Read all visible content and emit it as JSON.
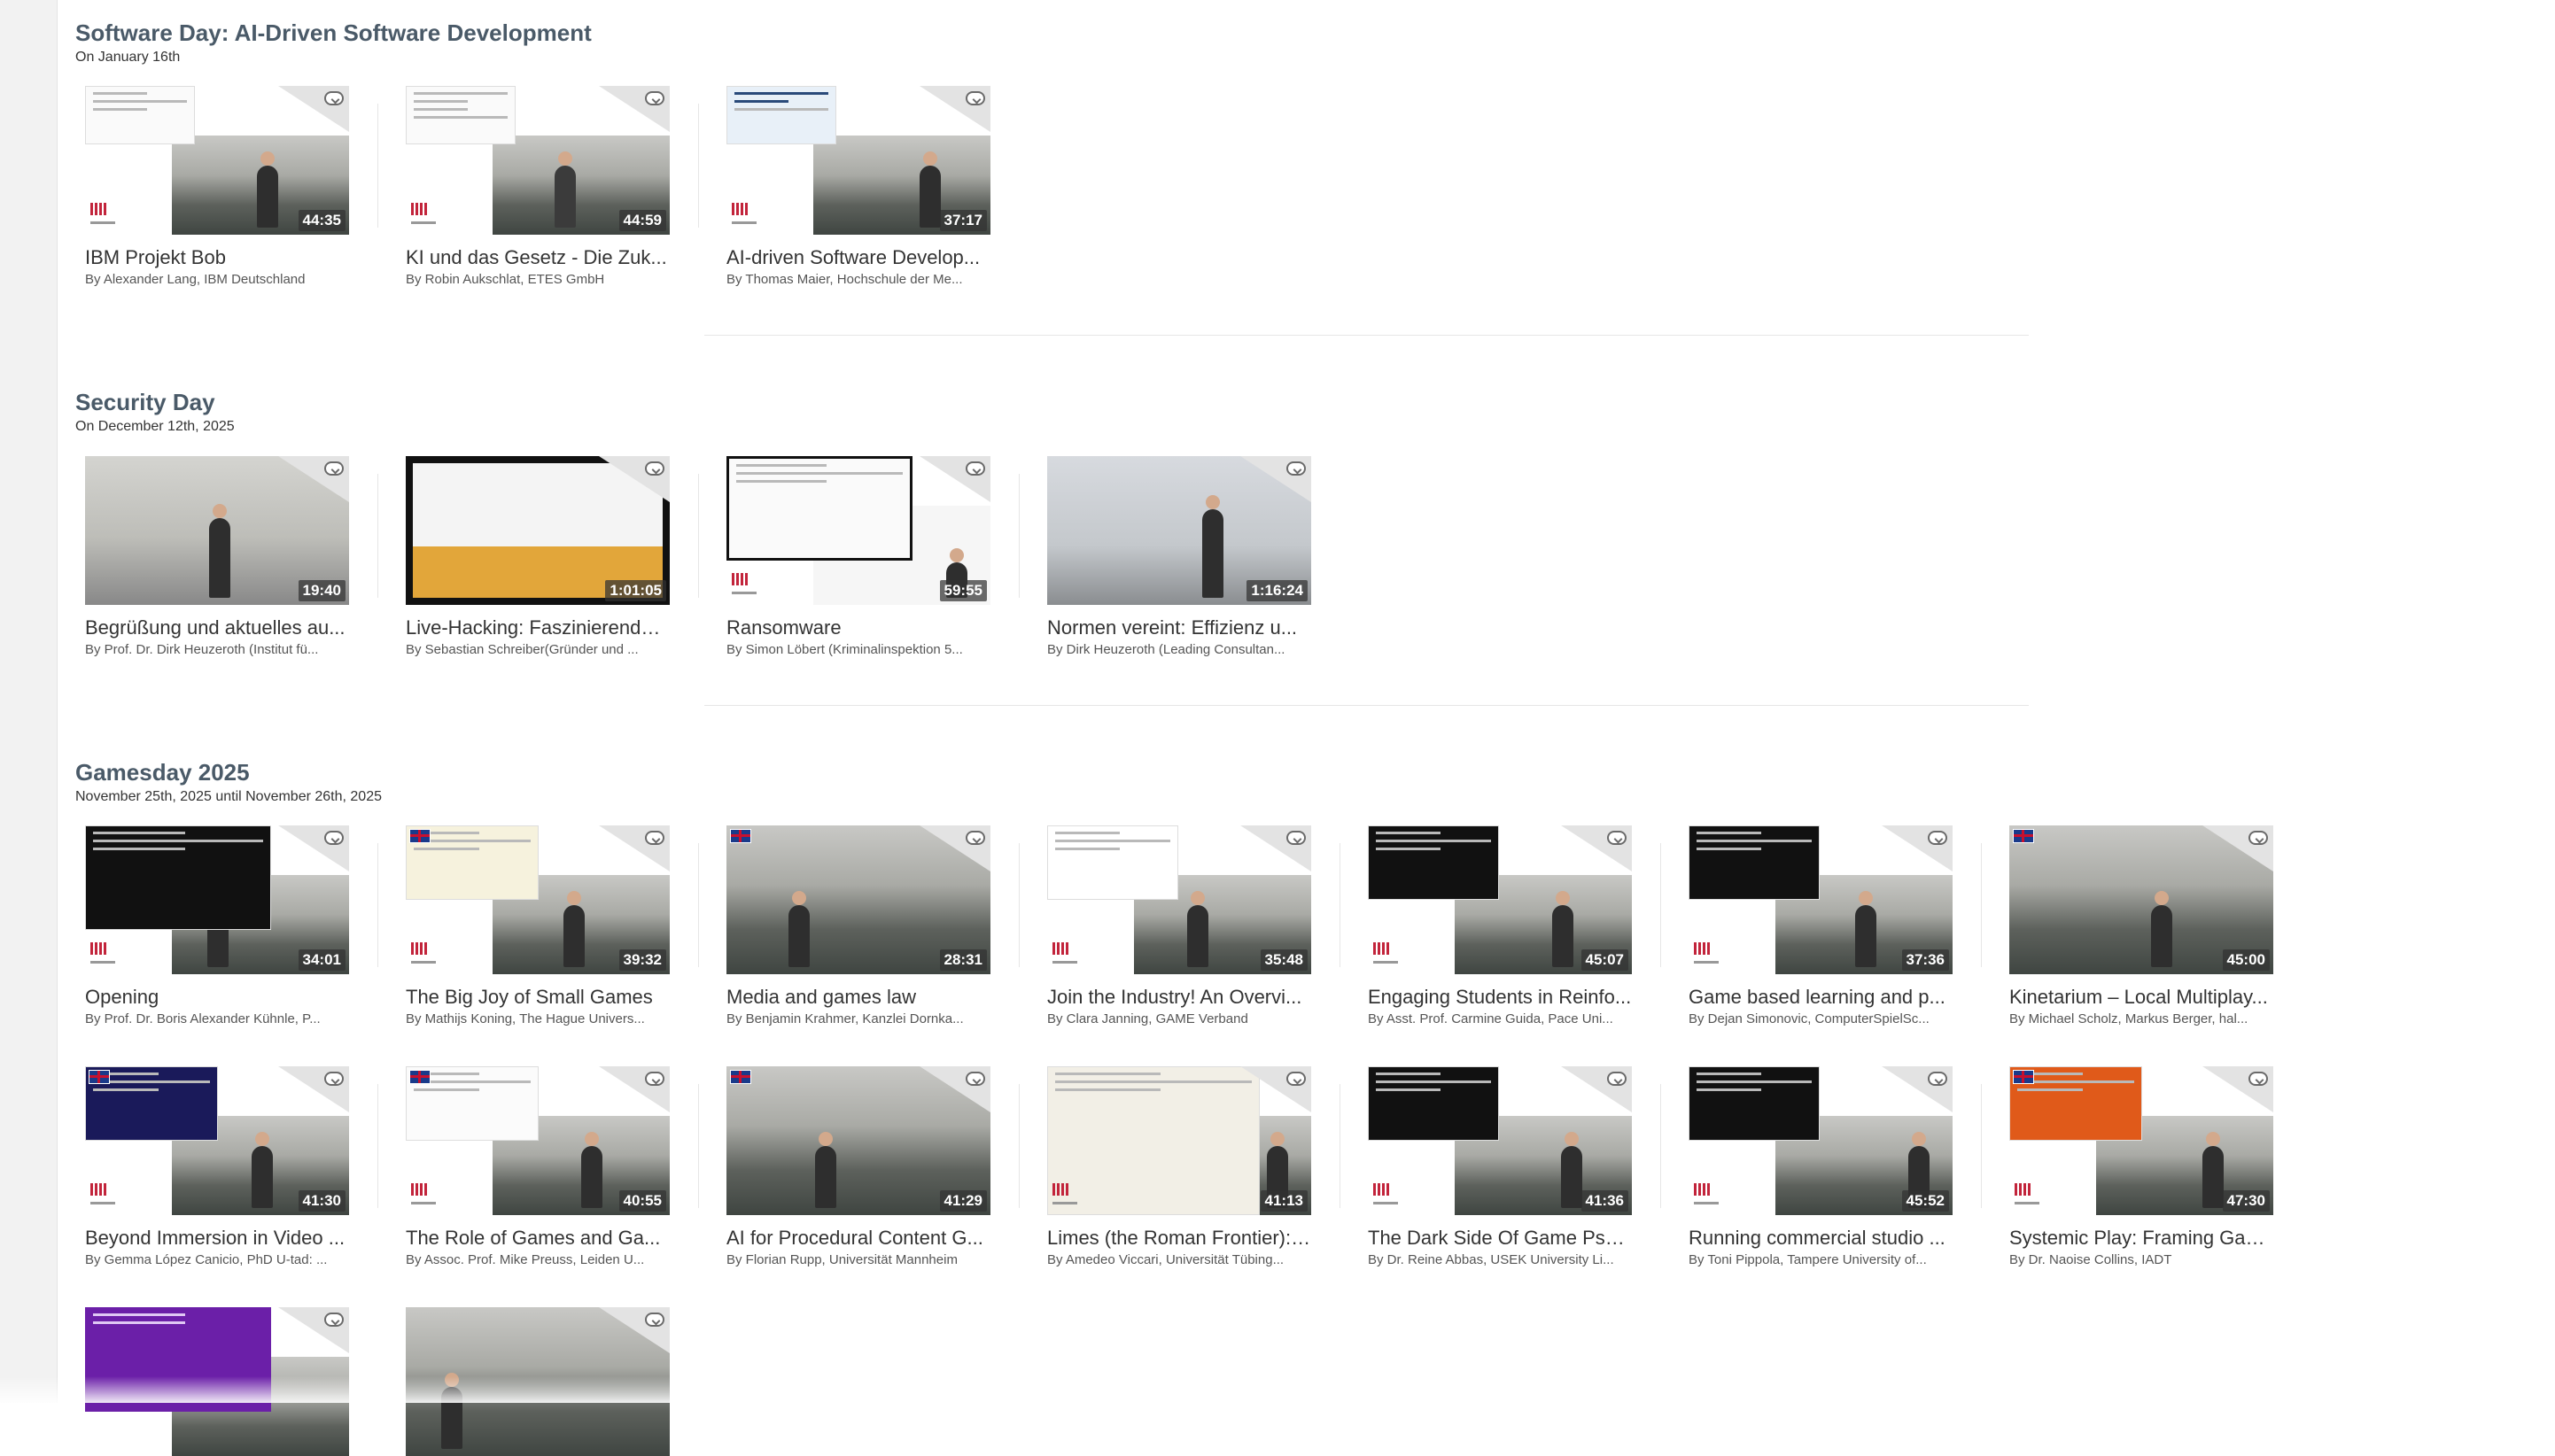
{
  "sections": [
    {
      "title": "Software Day: AI-Driven Software Development",
      "subtitle": "On January 16th",
      "videos": [
        {
          "title": "IBM Projekt Bob",
          "by": "By Alexander Lang, IBM Deutschland",
          "duration": "44:35"
        },
        {
          "title": "KI und das Gesetz - Die Zuk...",
          "by": "By Robin Aukschlat, ETES GmbH",
          "duration": "44:59"
        },
        {
          "title": "AI-driven Software Develop...",
          "by": "By Thomas Maier, Hochschule der Me...",
          "duration": "37:17"
        }
      ]
    },
    {
      "title": "Security Day",
      "subtitle": "On December 12th, 2025",
      "videos": [
        {
          "title": "Begrüßung und aktuelles au...",
          "by": "By Prof. Dr. Dirk Heuzeroth (Institut fü...",
          "duration": "19:40"
        },
        {
          "title": "Live-Hacking: Faszinierende ...",
          "by": "By Sebastian Schreiber(Gründer und ...",
          "duration": "1:01:05"
        },
        {
          "title": "Ransomware",
          "by": "By Simon Löbert (Kriminalinspektion 5...",
          "duration": "59:55"
        },
        {
          "title": "Normen vereint: Effizienz u...",
          "by": "By Dirk Heuzeroth (Leading Consultan...",
          "duration": "1:16:24"
        }
      ]
    },
    {
      "title": "Gamesday 2025",
      "subtitle": "November 25th, 2025 until November 26th, 2025",
      "videos": [
        {
          "title": "Opening",
          "by": "By Prof. Dr. Boris Alexander Kühnle, P...",
          "duration": "34:01"
        },
        {
          "title": "The Big Joy of Small Games",
          "by": "By Mathijs Koning, The Hague Univers...",
          "duration": "39:32"
        },
        {
          "title": "Media and games law",
          "by": "By Benjamin Krahmer, Kanzlei Dornka...",
          "duration": "28:31"
        },
        {
          "title": "Join the Industry! An Overvi...",
          "by": "By Clara Janning, GAME Verband",
          "duration": "35:48"
        },
        {
          "title": "Engaging Students in Reinfo...",
          "by": "By Asst. Prof. Carmine Guida, Pace Uni...",
          "duration": "45:07"
        },
        {
          "title": "Game based learning and p...",
          "by": "By Dejan Simonovic, ComputerSpielSc...",
          "duration": "37:36"
        },
        {
          "title": "Kinetarium – Local Multiplay...",
          "by": "By Michael Scholz, Markus Berger, hal...",
          "duration": "45:00"
        },
        {
          "title": "Beyond Immersion in Video ...",
          "by": "By Gemma López Canicio, PhD U-tad: ...",
          "duration": "41:30"
        },
        {
          "title": "The Role of Games and Ga...",
          "by": "By Assoc. Prof. Mike Preuss, Leiden U...",
          "duration": "40:55"
        },
        {
          "title": "AI for Procedural Content G...",
          "by": "By Florian Rupp, Universität Mannheim",
          "duration": "41:29"
        },
        {
          "title": "Limes (the Roman Frontier): ...",
          "by": "By Amedeo Viccari, Universität Tübing...",
          "duration": "41:13"
        },
        {
          "title": "The Dark Side Of Game Psyc...",
          "by": "By Dr. Reine Abbas, USEK University Li...",
          "duration": "41:36"
        },
        {
          "title": "Running commercial studio ...",
          "by": "By Toni Pippola, Tampere University of...",
          "duration": "45:52"
        },
        {
          "title": "Systemic Play: Framing Gam...",
          "by": "By Dr. Naoise Collins, IADT",
          "duration": "47:30"
        }
      ]
    }
  ],
  "icons": {
    "upload": "cloud-upload-icon",
    "flag": "uk-flag-icon",
    "logo": "hdm-logo-icon"
  }
}
